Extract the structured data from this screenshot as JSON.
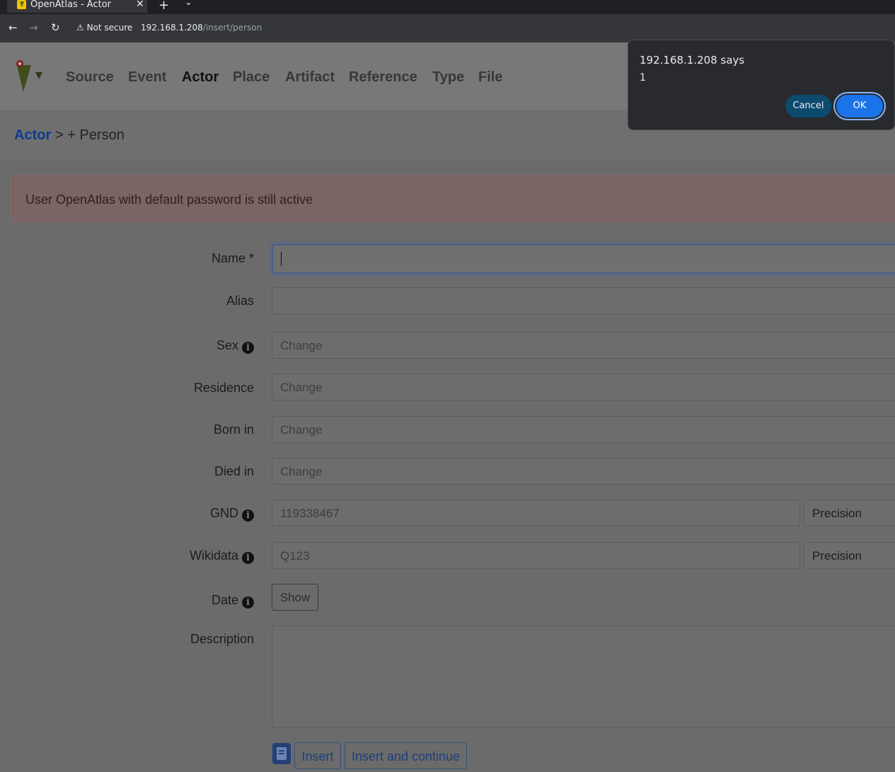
{
  "browser": {
    "tab_title": "OpenAtlas - Actor",
    "close_glyph": "✕",
    "new_tab_glyph": "+",
    "tab_menu_glyph": "⌄",
    "back_glyph": "←",
    "forward_glyph": "→",
    "reload_glyph": "↻",
    "security_label": "⚠ Not secure",
    "url_host": "192.168.1.208",
    "url_path": "/insert/person"
  },
  "nav": {
    "items": [
      {
        "label": "Source"
      },
      {
        "label": "Event"
      },
      {
        "label": "Actor"
      },
      {
        "label": "Place"
      },
      {
        "label": "Artifact"
      },
      {
        "label": "Reference"
      },
      {
        "label": "Type"
      },
      {
        "label": "File"
      }
    ]
  },
  "breadcrumb": {
    "link": "Actor",
    "rest": "> + Person"
  },
  "alert": {
    "text": "User OpenAtlas with default password is still active"
  },
  "form": {
    "name_label": "Name *",
    "alias_label": "Alias",
    "sex_label": "Sex",
    "residence_label": "Residence",
    "born_label": "Born in",
    "died_label": "Died in",
    "gnd_label": "GND",
    "wikidata_label": "Wikidata",
    "date_label": "Date",
    "description_label": "Description",
    "change_text": "Change",
    "gnd_placeholder": "119338467",
    "wikidata_placeholder": "Q123",
    "precision_text": "Precision",
    "show_label": "Show",
    "insert_label": "Insert",
    "insert_continue_label": "Insert and continue",
    "info_glyph": "i"
  },
  "dialog": {
    "title": "192.168.1.208 says",
    "message": "1",
    "cancel_label": "Cancel",
    "ok_label": "OK"
  }
}
